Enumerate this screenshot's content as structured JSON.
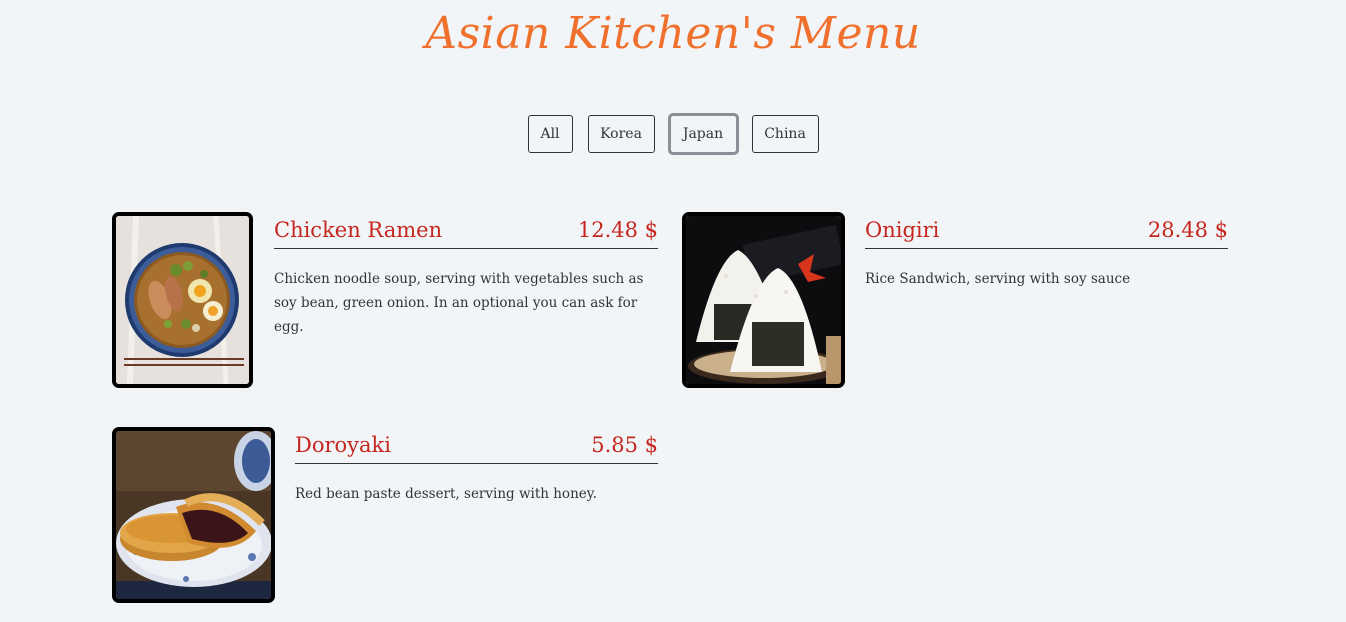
{
  "header": {
    "title": "Asian Kitchen's Menu"
  },
  "filters": [
    {
      "label": "All",
      "active": false
    },
    {
      "label": "Korea",
      "active": false
    },
    {
      "label": "Japan",
      "active": true
    },
    {
      "label": "China",
      "active": false
    }
  ],
  "menu": {
    "items": [
      {
        "name": "Chicken Ramen",
        "price": "12.48 $",
        "description": "Chicken noodle soup, serving with vegetables such as soy bean, green onion. In an optional you can ask for egg.",
        "image": "ramen-bowl-photo"
      },
      {
        "name": "Onigiri",
        "price": "28.48 $",
        "description": "Rice Sandwich, serving with soy sauce",
        "image": "onigiri-rice-balls-photo"
      },
      {
        "name": "Doroyaki",
        "price": "5.85 $",
        "description": "Red bean paste dessert, serving with honey.",
        "image": "dorayaki-pancakes-photo"
      }
    ]
  },
  "colors": {
    "background": "#f1f5f8",
    "title": "#f0712e",
    "item_name": "#c6261e",
    "text": "#333333"
  }
}
